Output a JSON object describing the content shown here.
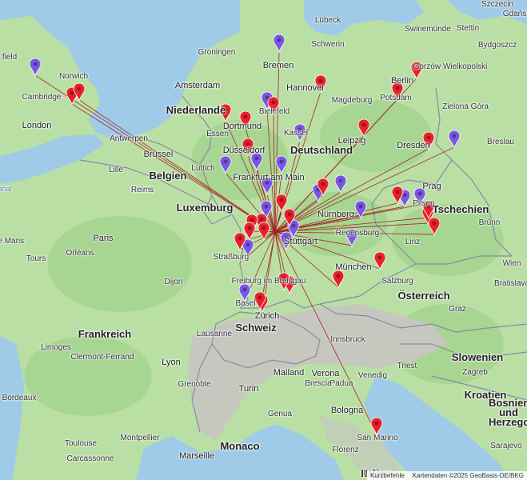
{
  "colors": {
    "sea": "#9fcbe8",
    "land": "#b9dfa4",
    "forest": "#9fd08a",
    "alps": "#c6c7bf",
    "border": "#8a8aa0",
    "line": "#a02020",
    "pin_red": "#e8202a",
    "pin_purple": "#7a55e6"
  },
  "countries": [
    {
      "label": "Niederlande"
    },
    {
      "label": "Deutschland"
    },
    {
      "label": "Belgien"
    },
    {
      "label": "Luxemburg"
    },
    {
      "label": "Frankreich"
    },
    {
      "label": "Schweiz"
    },
    {
      "label": "Österreich"
    },
    {
      "label": "Tschechien"
    },
    {
      "label": "Slowenien"
    },
    {
      "label": "Kroatien"
    },
    {
      "label": "Bosnien und Herzegowina"
    },
    {
      "label": "Monaco"
    },
    {
      "label": "Italien"
    }
  ],
  "cities": [
    "field",
    "Norwich",
    "Cambridge",
    "London",
    "Amsterdam",
    "Groningen",
    "Bremen",
    "Hannover",
    "Lübeck",
    "Schwerin",
    "Stettin",
    "Szczecin",
    "Gorzów Wielkopolski",
    "Bydgoszcz",
    "Zielona Góra",
    "Berlin",
    "Potsdam",
    "Magdeburg",
    "Leipzig",
    "Dresden",
    "Breslau",
    "Kassel",
    "Bielefeld",
    "Dortmund",
    "Essen",
    "Düsseldorf",
    "Antwerpen",
    "Brüssel",
    "Lille",
    "Lüttich",
    "Frankfurt am Main",
    "Nürnberg",
    "Regensburg",
    "Prag",
    "Pilsen",
    "Brünn",
    "Linz",
    "Salzburg",
    "München",
    "Innsbruck",
    "Stuttgart",
    "Straßburg",
    "Freiburg im Breisgau",
    "Basel",
    "Zürich",
    "Lausanne",
    "Paris",
    "Reims",
    "Le Mans",
    "Tours",
    "Orléans",
    "Dijon",
    "Lyon",
    "Clermont-Ferrand",
    "Limoges",
    "Bordeaux",
    "Toulouse",
    "Carcassonne",
    "Montpellier",
    "Marseille",
    "Grenoble",
    "Turin",
    "Genua",
    "Mailand",
    "Verona",
    "Venedig",
    "Padua",
    "Bologna",
    "Florenz",
    "Triest",
    "Zagreb",
    "Graz",
    "Wien",
    "Bratislava",
    "Sarajevo",
    "San Marino",
    "Swinemünde",
    "Brescia",
    "Italie",
    "Gdańsk",
    "Reims"
  ],
  "hub": "Stuttgart",
  "pins": {
    "red": [
      "Norwich A",
      "Norwich B",
      "Berlin",
      "Bydgoszcz",
      "Hannover",
      "Leipzig",
      "Dresden",
      "Dortmund",
      "Düsseldorf",
      "Bielefeld",
      "Frankfurt",
      "Pilsen",
      "Pilsen B",
      "Linz A",
      "Linz B",
      "Regensburg",
      "München",
      "München B",
      "Konstanz",
      "Freiburg",
      "Zürich A",
      "Zürich B",
      "Straßburg",
      "San Marino",
      "Würzburg",
      "Mannheim",
      "Heilbronn",
      "Karlsruhe",
      "Karlsruhe B",
      "Pforzheim",
      "Ulm"
    ],
    "purple": [
      "England",
      "Bremen",
      "Bielefeld",
      "Kassel",
      "Köln",
      "Koblenz",
      "Frankfurt",
      "Darmstadt",
      "Nürnberg",
      "Nürnberg B",
      "Prag",
      "Prag B",
      "Bayreuth",
      "Breslau",
      "Basel",
      "Straßburg",
      "Regensburg",
      "Stuttgart",
      "Heidelberg",
      "Mainz"
    ]
  },
  "attribution": {
    "shortcuts": "Kurzbefehle",
    "data": "Kartendaten ©2025 GeoBasis-DE/BKG"
  },
  "water_label": "anal"
}
